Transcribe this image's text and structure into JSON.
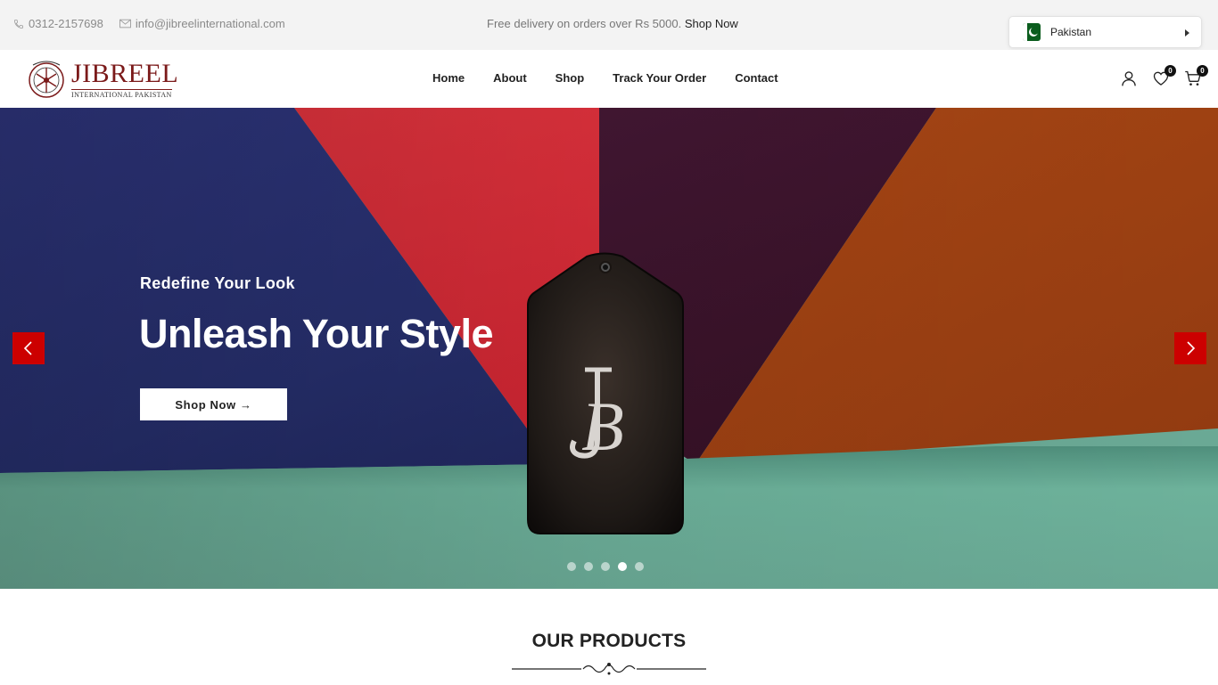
{
  "topbar": {
    "phone": "0312-2157698",
    "email": "info@jibreelinternational.com",
    "promo_text": "Free delivery on orders over Rs 5000.",
    "promo_link": "Shop Now",
    "country": "Pakistan"
  },
  "header": {
    "logo_text": "JIBREEL",
    "logo_subtext": "INTERNATIONAL PAKISTAN",
    "nav": [
      {
        "label": "Home"
      },
      {
        "label": "About"
      },
      {
        "label": "Shop"
      },
      {
        "label": "Track Your Order"
      },
      {
        "label": "Contact"
      }
    ],
    "wishlist_count": "0",
    "cart_count": "0"
  },
  "hero": {
    "eyebrow": "Redefine Your Look",
    "headline": "Unleash Your Style",
    "cta": "Shop Now →",
    "slides": 5,
    "active_slide": 4
  },
  "section": {
    "title": "OUR PRODUCTS"
  },
  "colors": {
    "accent_red": "#cc0000",
    "brand": "#7b1a1a"
  }
}
